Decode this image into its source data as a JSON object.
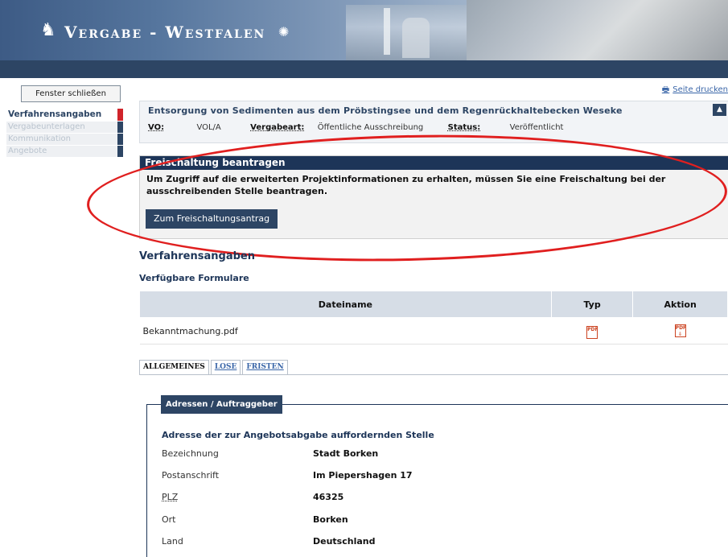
{
  "header": {
    "logo_text": "Vergabe - Westfalen",
    "logo_emblem_icon": "horse-emblem-icon",
    "logo_star_icon": "star-emblem-icon"
  },
  "sidebar": {
    "close_button": "Fenster schließen",
    "items": [
      {
        "label": "Verfahrensangaben",
        "active": true
      },
      {
        "label": "Vergabeunterlagen",
        "active": false
      },
      {
        "label": "Kommunikation",
        "active": false
      },
      {
        "label": "Angebote",
        "active": false
      }
    ]
  },
  "print_link": "Seite drucken",
  "project": {
    "title": "Entsorgung von Sedimenten aus dem Pröbstingsee und dem Regenrückhaltebecken Weseke",
    "vo_label": "VO:",
    "vo_value": "VOL/A",
    "vergabeart_label": "Vergabeart:",
    "vergabeart_value": "Öffentliche Ausschreibung",
    "status_label": "Status:",
    "status_value": "Veröffentlicht"
  },
  "unlock": {
    "title": "Freischaltung beantragen",
    "text": "Um Zugriff auf die erweiterten Projektinformationen zu erhalten, müssen Sie eine Freischaltung bei der ausschreibenden Stelle beantragen.",
    "button": "Zum Freischaltungsantrag"
  },
  "section_title": "Verfahrensangaben",
  "forms": {
    "title": "Verfügbare Formulare",
    "columns": [
      "Dateiname",
      "Typ",
      "Aktion"
    ],
    "rows": [
      {
        "filename": "Bekanntmachung.pdf",
        "type_icon": "pdf-icon",
        "action_icon": "pdf-download-icon"
      }
    ]
  },
  "tabs": [
    "ALLGEMEINES",
    "LOSE",
    "FRISTEN"
  ],
  "address_section": {
    "legend": "Adressen / Auftraggeber",
    "title": "Adresse der zur Angebotsabgabe auffordernden Stelle",
    "rows": [
      {
        "label": "Bezeichnung",
        "value": "Stadt Borken"
      },
      {
        "label": "Postanschrift",
        "value": "Im Piepershagen 17"
      },
      {
        "label": "PLZ",
        "value": "46325"
      },
      {
        "label": "Ort",
        "value": "Borken"
      },
      {
        "label": "Land",
        "value": "Deutschland"
      }
    ]
  },
  "colors": {
    "navy": "#1d3558",
    "nav_blue": "#2d4564",
    "annotation_red": "#e01f1f",
    "active_marker": "#d0242b"
  }
}
